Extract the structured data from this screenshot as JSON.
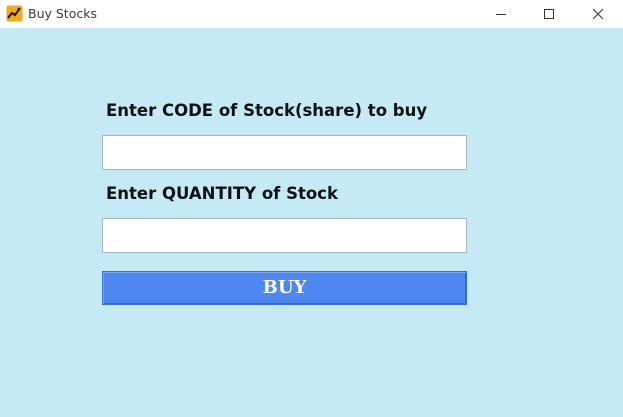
{
  "window": {
    "title": "Buy Stocks",
    "icon": "stock-chart-icon",
    "controls": {
      "minimize": "minimize-icon",
      "maximize": "maximize-icon",
      "close": "close-icon"
    }
  },
  "form": {
    "code_label": "Enter CODE of Stock(share) to buy",
    "code_value": "",
    "quantity_label": "Enter QUANTITY of Stock",
    "quantity_value": "",
    "buy_label": "BUY"
  },
  "colors": {
    "background": "#c5eaf5",
    "button": "#4f87f0",
    "button_text": "#ffffff"
  }
}
